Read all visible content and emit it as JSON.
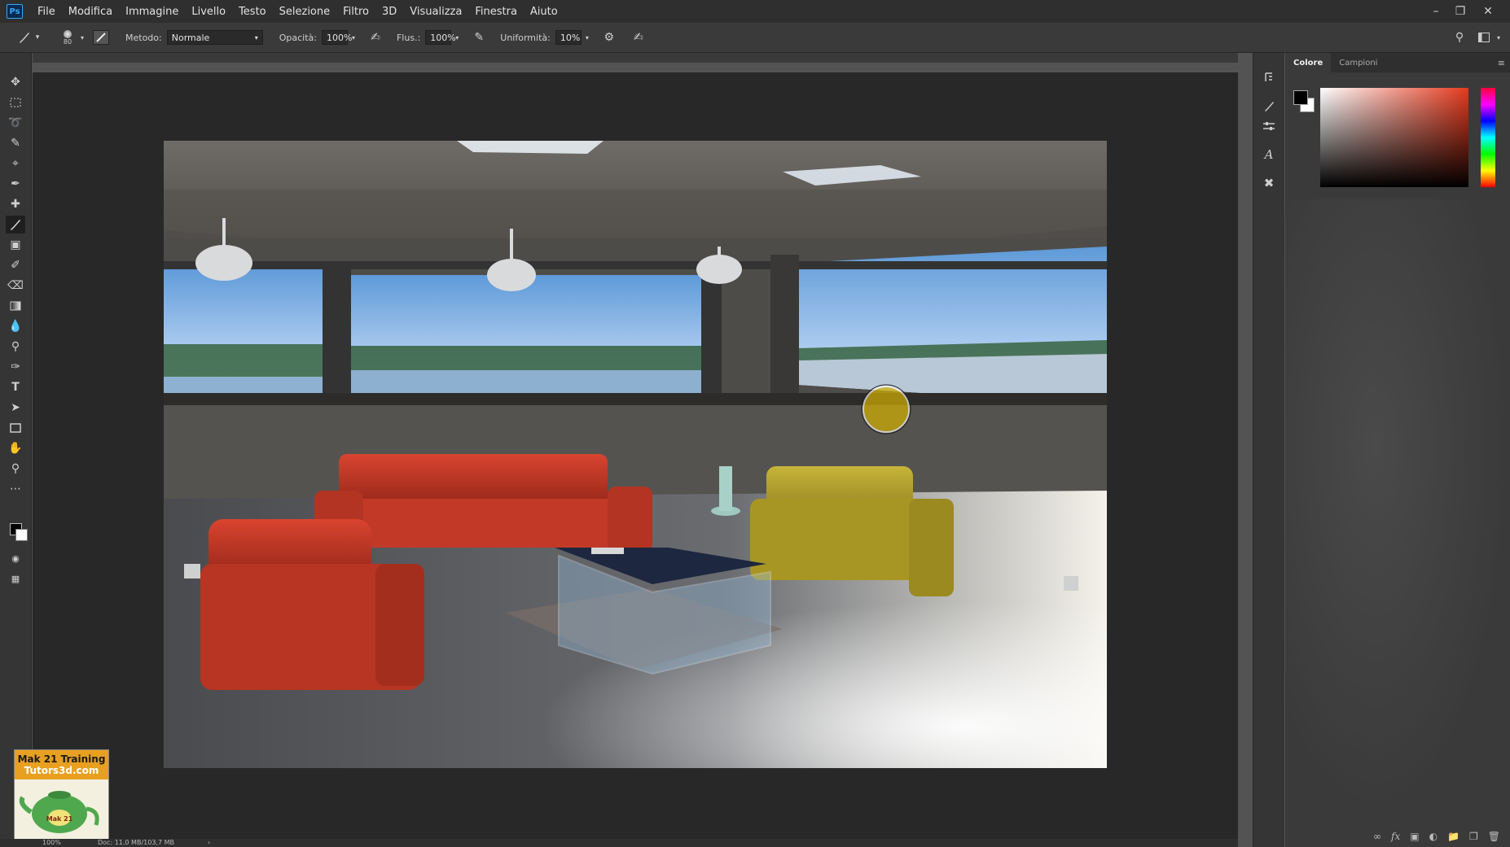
{
  "app": {
    "logo": "Ps"
  },
  "menu": [
    "File",
    "Modifica",
    "Immagine",
    "Livello",
    "Testo",
    "Selezione",
    "Filtro",
    "3D",
    "Visualizza",
    "Finestra",
    "Aiuto"
  ],
  "options": {
    "brush_size": "80",
    "metodo_label": "Metodo:",
    "metodo_value": "Normale",
    "opacita_label": "Opacità:",
    "opacita_value": "100%",
    "flusso_label": "Flus.:",
    "flusso_value": "100%",
    "uniformita_label": "Uniformità:",
    "uniformita_value": "10%"
  },
  "panel": {
    "tabs": [
      "Colore",
      "Campioni"
    ],
    "active_tab": "Colore",
    "hue_color": "#e53a1e",
    "foreground": "#000000",
    "background": "#ffffff"
  },
  "status": {
    "zoom": "100%",
    "doc": "Doc: 11,0 MB/103,7 MB"
  },
  "watermark": {
    "line1": "Mak 21 Training",
    "line2": "Tutors3d.com",
    "logo_text": "Mak 21"
  },
  "colors": {
    "accent": "#31a8ff",
    "sofa": "#c0392b",
    "armchair_yellow": "#b5a12a",
    "brush_cursor": "#d4b000"
  }
}
